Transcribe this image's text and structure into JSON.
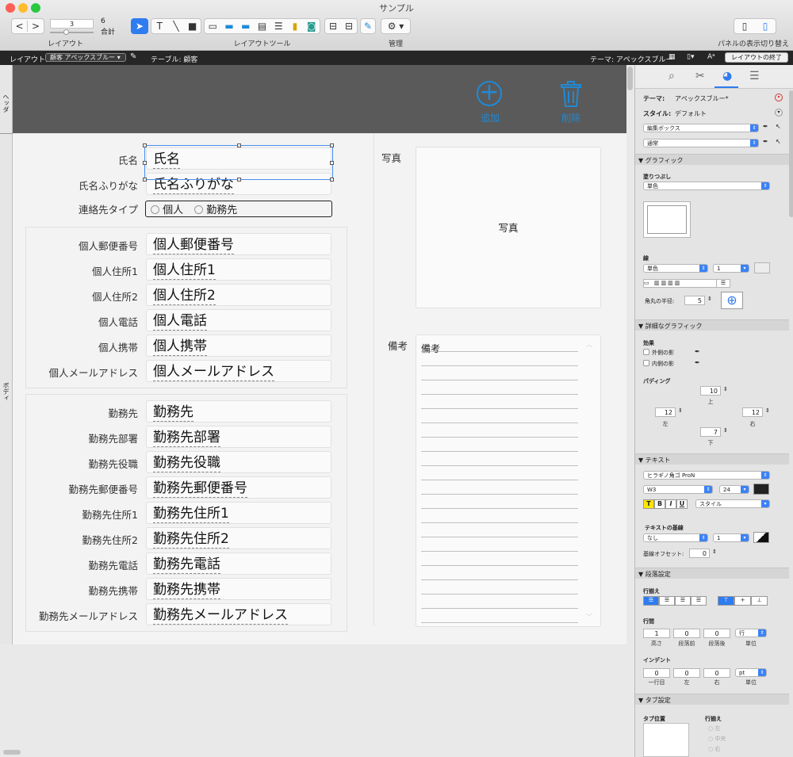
{
  "window": {
    "title": "サンプル"
  },
  "toolbar": {
    "page_number": "3",
    "page_total": "6",
    "page_total_label": "合計",
    "layout_label": "レイアウト",
    "layout_tools_label": "レイアウトツール",
    "manage_label": "管理",
    "panel_toggle_label": "パネルの表示切り替え"
  },
  "layout_bar": {
    "layout_prefix": "レイアウト:",
    "layout_name": "顧客 アペックスブルー",
    "table_text": "テーブル: 顧客",
    "theme_text": "テーマ: アペックスブルー",
    "exit_button": "レイアウトの終了"
  },
  "parts": {
    "header": "ヘッダ",
    "body": "ボディ"
  },
  "header_buttons": {
    "add": "追加",
    "delete": "削除"
  },
  "form": {
    "top_fields": [
      {
        "label": "氏名",
        "value": "氏名"
      },
      {
        "label": "氏名ふりがな",
        "value": "氏名ふりがな"
      }
    ],
    "contact_type": {
      "label": "連絡先タイプ",
      "options": [
        "個人",
        "勤務先"
      ]
    },
    "personal_fields": [
      {
        "label": "個人郵便番号",
        "value": "個人郵便番号"
      },
      {
        "label": "個人住所1",
        "value": "個人住所1"
      },
      {
        "label": "個人住所2",
        "value": "個人住所2"
      },
      {
        "label": "個人電話",
        "value": "個人電話"
      },
      {
        "label": "個人携帯",
        "value": "個人携帯"
      },
      {
        "label": "個人メールアドレス",
        "value": "個人メールアドレス"
      }
    ],
    "work_fields": [
      {
        "label": "勤務先",
        "value": "勤務先"
      },
      {
        "label": "勤務先部署",
        "value": "勤務先部署"
      },
      {
        "label": "勤務先役職",
        "value": "勤務先役職"
      },
      {
        "label": "勤務先郵便番号",
        "value": "勤務先郵便番号"
      },
      {
        "label": "勤務先住所1",
        "value": "勤務先住所1"
      },
      {
        "label": "勤務先住所2",
        "value": "勤務先住所2"
      },
      {
        "label": "勤務先電話",
        "value": "勤務先電話"
      },
      {
        "label": "勤務先携帯",
        "value": "勤務先携帯"
      },
      {
        "label": "勤務先メールアドレス",
        "value": "勤務先メールアドレス"
      }
    ],
    "photo": {
      "label": "写真",
      "value": "写真"
    },
    "notes": {
      "label": "備考",
      "value": "備考"
    }
  },
  "inspector": {
    "theme_label": "テーマ:",
    "theme_value": "アペックスブルー*",
    "style_label": "スタイル:",
    "style_value": "デフォルト",
    "object_select": "編集ボックス",
    "state_select": "通常",
    "graphic": {
      "title": "▼ グラフィック",
      "fill_label": "塗りつぶし",
      "fill_value": "単色",
      "line_label": "線",
      "line_type": "単色",
      "line_width": "1",
      "radius_label": "角丸の半径:",
      "radius_value": "5"
    },
    "advanced": {
      "title": "▼ 詳細なグラフィック",
      "effects_label": "効果",
      "outer_shadow": "外側の影",
      "inner_shadow": "内側の影",
      "padding_label": "パディング",
      "pad_top": "10",
      "pad_top_label": "上",
      "pad_left": "12",
      "pad_left_label": "左",
      "pad_right": "12",
      "pad_right_label": "右",
      "pad_bottom": "7",
      "pad_bottom_label": "下"
    },
    "text": {
      "title": "▼ テキスト",
      "font": "ヒラギノ角ゴ ProN",
      "weight": "W3",
      "size": "24",
      "style_select": "スタイル",
      "baseline_label": "テキストの基線",
      "baseline_value": "なし",
      "baseline_width": "1",
      "baseline_offset_label": "基線オフセット:",
      "baseline_offset": "0"
    },
    "paragraph": {
      "title": "▼ 段落設定",
      "align_label": "行揃え",
      "spacing_label": "行間",
      "height": "1",
      "height_label": "高さ",
      "before": "0",
      "before_label": "段落前",
      "after": "0",
      "after_label": "段落後",
      "unit": "行",
      "unit_label": "単位",
      "indent_label": "インデント",
      "first": "0",
      "first_label": "一行目",
      "left": "0",
      "left_label": "左",
      "right": "0",
      "right_label": "右",
      "indent_unit": "pt",
      "indent_unit_label": "単位"
    },
    "tabs": {
      "title": "▼ タブ設定",
      "position_label": "タブ位置",
      "align_label": "行揃え",
      "opt_left": "左",
      "opt_center": "中央",
      "opt_right": "右"
    }
  },
  "colors": {
    "accent": "#1f8ad6",
    "header_bg": "#5a5a5a",
    "selection": "#4a8ef0"
  }
}
